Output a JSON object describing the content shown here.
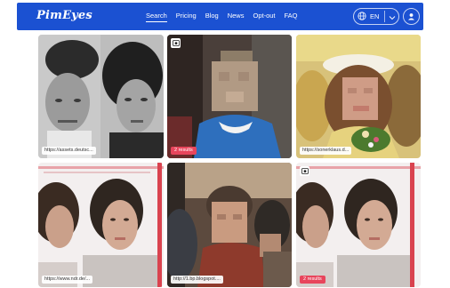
{
  "brand": {
    "logo_text": "PimEyes"
  },
  "nav": {
    "links": [
      {
        "label": "Search",
        "active": true
      },
      {
        "label": "Pricing",
        "active": false
      },
      {
        "label": "Blog",
        "active": false
      },
      {
        "label": "News",
        "active": false
      },
      {
        "label": "Opt-out",
        "active": false
      },
      {
        "label": "FAQ",
        "active": false
      }
    ],
    "language": "EN",
    "icons": [
      "globe-icon",
      "chevron-down-icon",
      "user-icon"
    ]
  },
  "results": [
    {
      "url": "https://assets.deutsc...",
      "badge": ""
    },
    {
      "url": "",
      "badge": "2 results"
    },
    {
      "url": "https://sonerklaus.d...",
      "badge": ""
    },
    {
      "url": "https://www.ndr.de/...",
      "badge": ""
    },
    {
      "url": "http://1.bp.blogspot....",
      "badge": ""
    },
    {
      "url": "",
      "badge": "2 results"
    }
  ],
  "colors": {
    "nav_bg": "#1b51d2",
    "badge_bg": "#e8455c"
  }
}
